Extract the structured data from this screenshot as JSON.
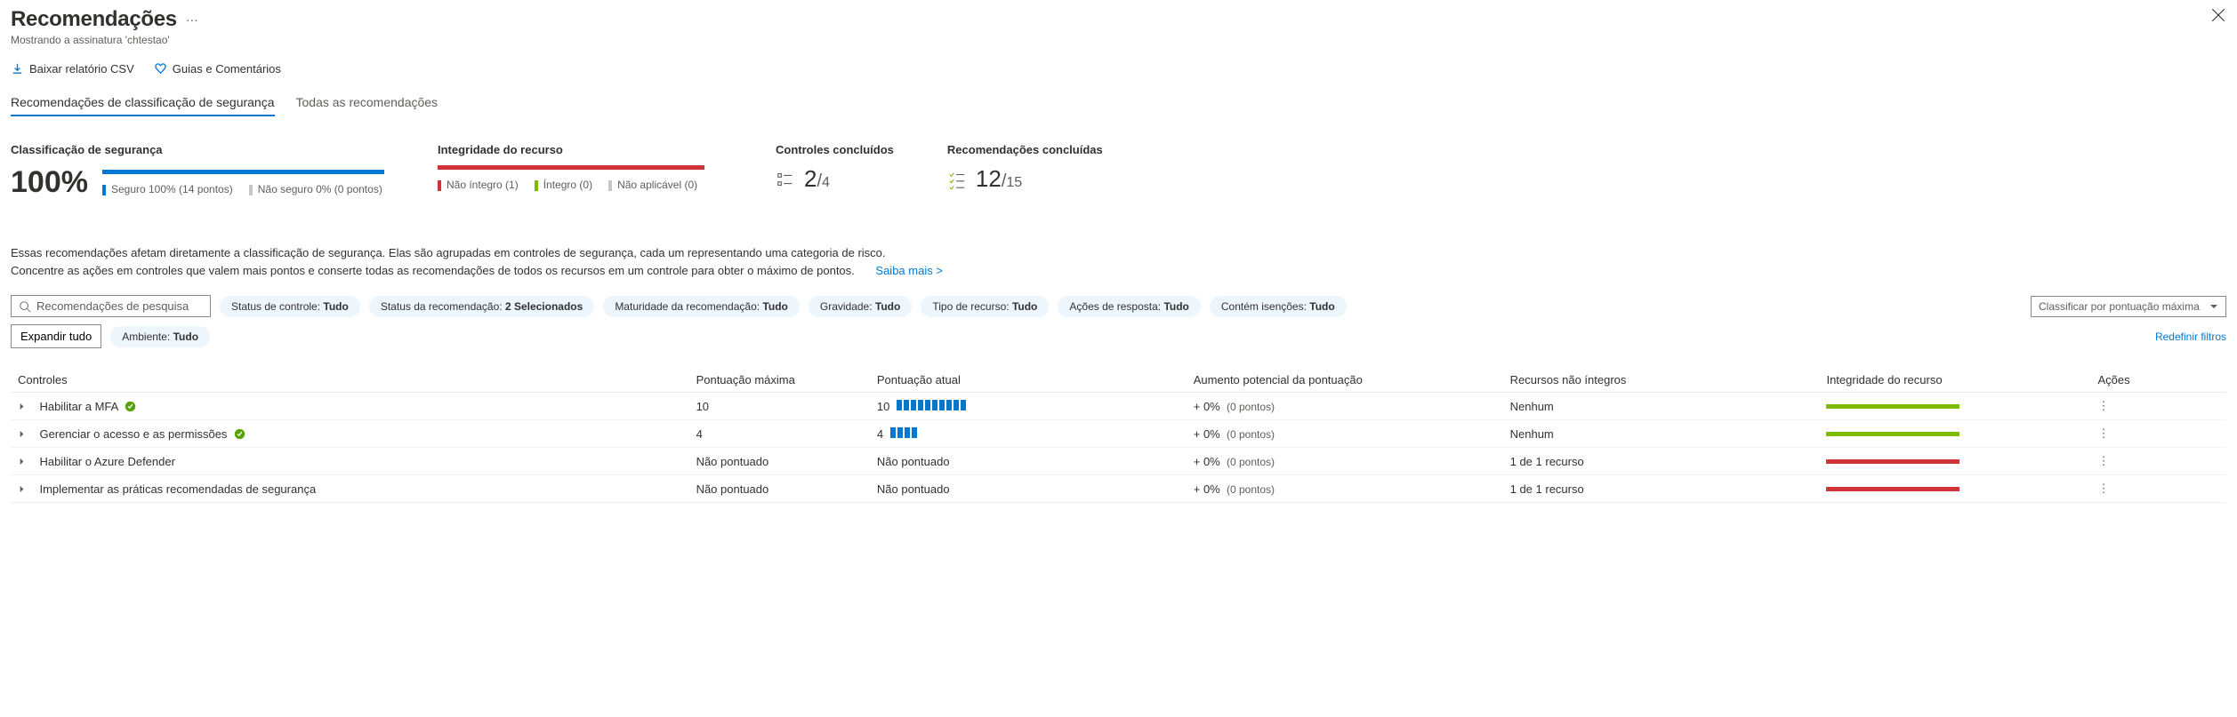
{
  "header": {
    "title": "Recomendações",
    "subtitle": "Mostrando a assinatura 'chtestao'"
  },
  "actions": {
    "download": "Baixar relatório CSV",
    "guide": "Guias e Comentários"
  },
  "tabs": {
    "active": "Recomendações de classificação de segurança",
    "all": "Todas as recomendações"
  },
  "summary": {
    "score_label": "Classificação de segurança",
    "score_pct": "100%",
    "legend_secure": "Seguro 100% (14 pontos)",
    "legend_insecure": "Não seguro 0% (0 pontos)",
    "health_label": "Integridade do recurso",
    "health_unhealthy": "Não íntegro (1)",
    "health_healthy": "Íntegro (0)",
    "health_na": "Não aplicável (0)",
    "controls_label": "Controles concluídos",
    "controls_big": "2",
    "controls_small": "4",
    "recs_label": "Recomendações concluídas",
    "recs_big": "12",
    "recs_small": "15"
  },
  "description": {
    "line1": "Essas recomendações afetam diretamente a classificação de segurança. Elas são agrupadas em controles de segurança, cada um representando uma categoria de risco.",
    "line2": "Concentre as ações em controles que valem mais pontos e conserte todas as recomendações de todos os recursos em um controle para obter o máximo de pontos.",
    "learn_more": "Saiba mais >"
  },
  "filters": {
    "search_placeholder": "Recomendações de pesquisa",
    "pills": [
      {
        "label": "Status de controle:",
        "value": "Tudo"
      },
      {
        "label": "Status da recomendação:",
        "value": "2 Selecionados"
      },
      {
        "label": "Maturidade da recomendação:",
        "value": "Tudo"
      },
      {
        "label": "Gravidade:",
        "value": "Tudo"
      },
      {
        "label": "Tipo de recurso:",
        "value": "Tudo"
      },
      {
        "label": "Ações de resposta:",
        "value": "Tudo"
      },
      {
        "label": "Contém isenções:",
        "value": "Tudo"
      }
    ],
    "sort_placeholder": "Classificar por pontuação máxima",
    "expand_all": "Expandir tudo",
    "env_pill": {
      "label": "Ambiente:",
      "value": "Tudo"
    },
    "reset": "Redefinir filtros"
  },
  "table": {
    "headers": {
      "controls": "Controles",
      "max_score": "Pontuação máxima",
      "current_score": "Pontuação atual",
      "potential": "Aumento potencial da pontuação",
      "unhealthy": "Recursos não íntegros",
      "health": "Integridade do recurso",
      "actions": "Ações"
    },
    "rows": [
      {
        "name": "Habilitar a MFA",
        "badge": true,
        "max": "10",
        "cur": "10",
        "bars": 10,
        "inc": "+ 0%",
        "incsub": "(0 pontos)",
        "unh": "Nenhum",
        "health": "green"
      },
      {
        "name": "Gerenciar o acesso e as permissões",
        "badge": true,
        "max": "4",
        "cur": "4",
        "bars": 4,
        "inc": "+ 0%",
        "incsub": "(0 pontos)",
        "unh": "Nenhum",
        "health": "green"
      },
      {
        "name": "Habilitar o Azure Defender",
        "badge": false,
        "max": "Não pontuado",
        "cur": "Não pontuado",
        "bars": 0,
        "inc": "+ 0%",
        "incsub": "(0 pontos)",
        "unh": "1 de 1 recurso",
        "health": "red"
      },
      {
        "name": "Implementar as práticas recomendadas de segurança",
        "badge": false,
        "max": "Não pontuado",
        "cur": "Não pontuado",
        "bars": 0,
        "inc": "+ 0%",
        "incsub": "(0 pontos)",
        "unh": "1 de 1 recurso",
        "health": "red"
      }
    ]
  }
}
